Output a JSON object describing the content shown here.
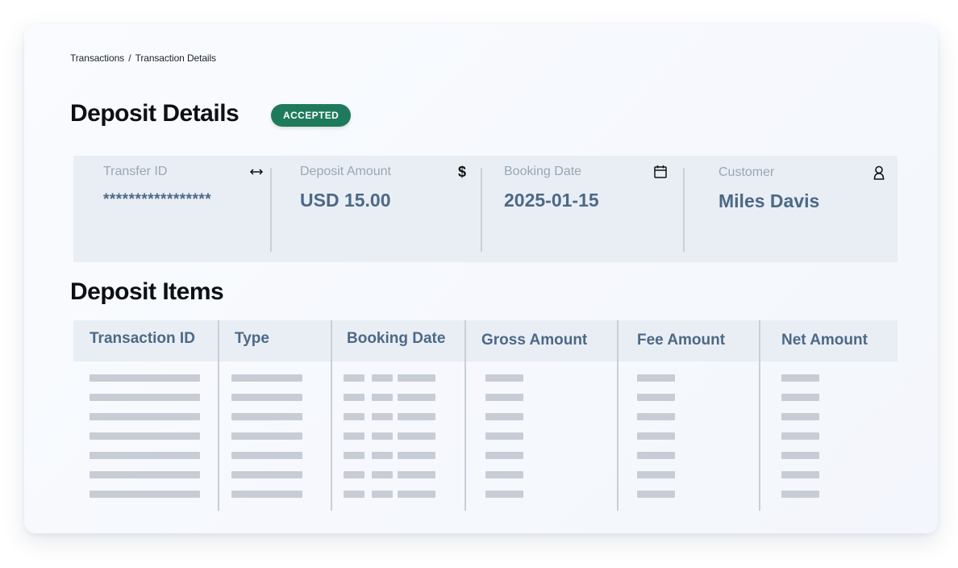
{
  "breadcrumb": {
    "root": "Transactions",
    "separator": "/",
    "current": "Transaction Details"
  },
  "header": {
    "title": "Deposit Details",
    "status_badge": "ACCEPTED",
    "status_color": "#1f7a5c"
  },
  "summary": [
    {
      "label": "Transfer ID",
      "value": "*****************",
      "icon": "transfer-arrows-icon"
    },
    {
      "label": "Deposit Amount",
      "value": "USD 15.00",
      "icon": "dollar-icon"
    },
    {
      "label": "Booking Date",
      "value": "2025-01-15",
      "icon": "calendar-icon"
    },
    {
      "label": "Customer",
      "value": "Miles Davis",
      "icon": "person-icon"
    }
  ],
  "items": {
    "title": "Deposit Items",
    "columns": [
      "Transaction ID",
      "Type",
      "Booking Date",
      "Gross Amount",
      "Fee Amount",
      "Net Amount"
    ],
    "placeholder_row_count": 7
  },
  "colors": {
    "accent_text": "#4c6986",
    "panel_bg": "#e9eef5",
    "placeholder": "#c8cdd5"
  }
}
